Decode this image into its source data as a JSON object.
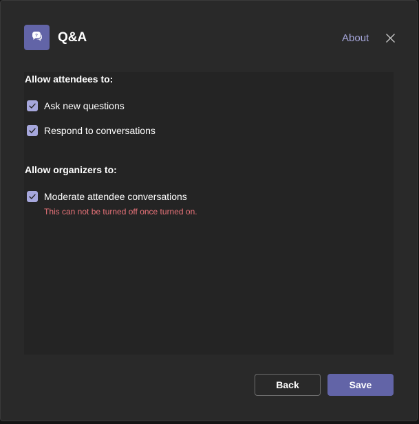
{
  "header": {
    "title": "Q&A",
    "about_label": "About",
    "app_icon": "chat-bubbles-icon",
    "close_icon": "close-icon"
  },
  "attendees": {
    "heading": "Allow attendees to:",
    "options": [
      {
        "label": "Ask new questions",
        "checked": true
      },
      {
        "label": "Respond to conversations",
        "checked": true
      }
    ]
  },
  "organizers": {
    "heading": "Allow organizers to:",
    "options": [
      {
        "label": "Moderate attendee conversations",
        "checked": true
      }
    ],
    "warning": "This can not be turned off once turned on."
  },
  "footer": {
    "back_label": "Back",
    "save_label": "Save"
  },
  "colors": {
    "accent": "#6264a7",
    "checkbox": "#a6a7dc",
    "link": "#a6a7dc",
    "warning": "#e87379",
    "background": "#292929",
    "panel": "#242424"
  }
}
